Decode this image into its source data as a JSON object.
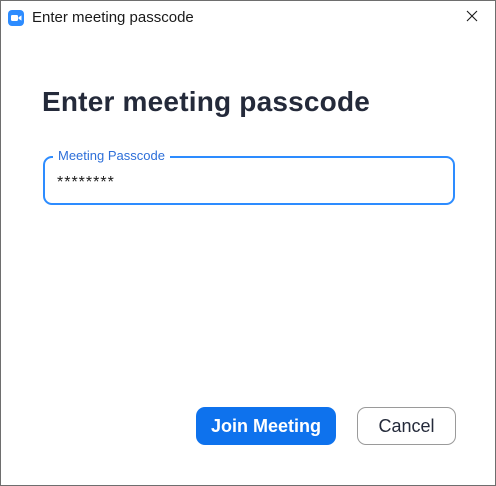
{
  "window": {
    "title": "Enter meeting passcode",
    "app_icon": "zoom-camera-icon",
    "close_icon": "close-icon"
  },
  "main": {
    "heading": "Enter meeting passcode",
    "passcode_field": {
      "label": "Meeting Passcode",
      "value": "********"
    }
  },
  "actions": {
    "join_label": "Join Meeting",
    "cancel_label": "Cancel"
  },
  "colors": {
    "accent": "#2d8cff",
    "primary_button": "#0e72ed",
    "heading_text": "#242a3a"
  }
}
